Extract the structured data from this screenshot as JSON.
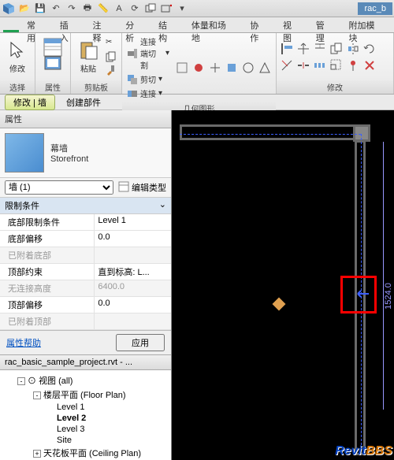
{
  "titlebar": {
    "filename": "rac_b"
  },
  "tabs": [
    "",
    "常用",
    "插入",
    "注释",
    "分析",
    "结构",
    "体量和场地",
    "协作",
    "视图",
    "管理",
    "附加模块"
  ],
  "ribbon": {
    "select": {
      "modify": "修改",
      "group": "选择"
    },
    "properties": {
      "group": "属性"
    },
    "clipboard": {
      "paste": "粘贴",
      "group": "剪贴板"
    },
    "geometry": {
      "cut_join_switch": "连接端切割",
      "cut": "剪切",
      "join": "连接",
      "group": "几何图形"
    },
    "modify_group": {
      "group": "修改"
    }
  },
  "context_tabs": {
    "a": "修改 | 墙",
    "b": "创建部件"
  },
  "props_panel": {
    "title": "属性",
    "type_name": "幕墙",
    "type_sub": "Storefront",
    "selector": "墙 (1)",
    "edit_type": "编辑类型",
    "cat": "限制条件",
    "rows": [
      {
        "label": "底部限制条件",
        "value": "Level 1"
      },
      {
        "label": "底部偏移",
        "value": "0.0"
      },
      {
        "label": "已附着底部",
        "value": ""
      },
      {
        "label": "顶部约束",
        "value": "直到标高: L..."
      },
      {
        "label": "无连接高度",
        "value": "6400.0",
        "disabled": true
      },
      {
        "label": "顶部偏移",
        "value": "0.0"
      },
      {
        "label": "已附着顶部",
        "value": ""
      }
    ],
    "help": "属性帮助",
    "apply": "应用"
  },
  "browser": {
    "title": "rac_basic_sample_project.rvt - ...",
    "items": [
      {
        "label": "视图 (all)",
        "level": 1,
        "tog": "-"
      },
      {
        "label": "楼层平面 (Floor Plan)",
        "level": 2,
        "tog": "-"
      },
      {
        "label": "Level 1",
        "level": 3
      },
      {
        "label": "Level 2",
        "level": 3,
        "bold": true
      },
      {
        "label": "Level 3",
        "level": 3
      },
      {
        "label": "Site",
        "level": 3
      },
      {
        "label": "天花板平面 (Ceiling Plan)",
        "level": 2,
        "tog": "+"
      }
    ]
  },
  "viewport": {
    "dim": "1524.0"
  },
  "watermark": {
    "a": "Revit",
    "b": "BBS"
  }
}
